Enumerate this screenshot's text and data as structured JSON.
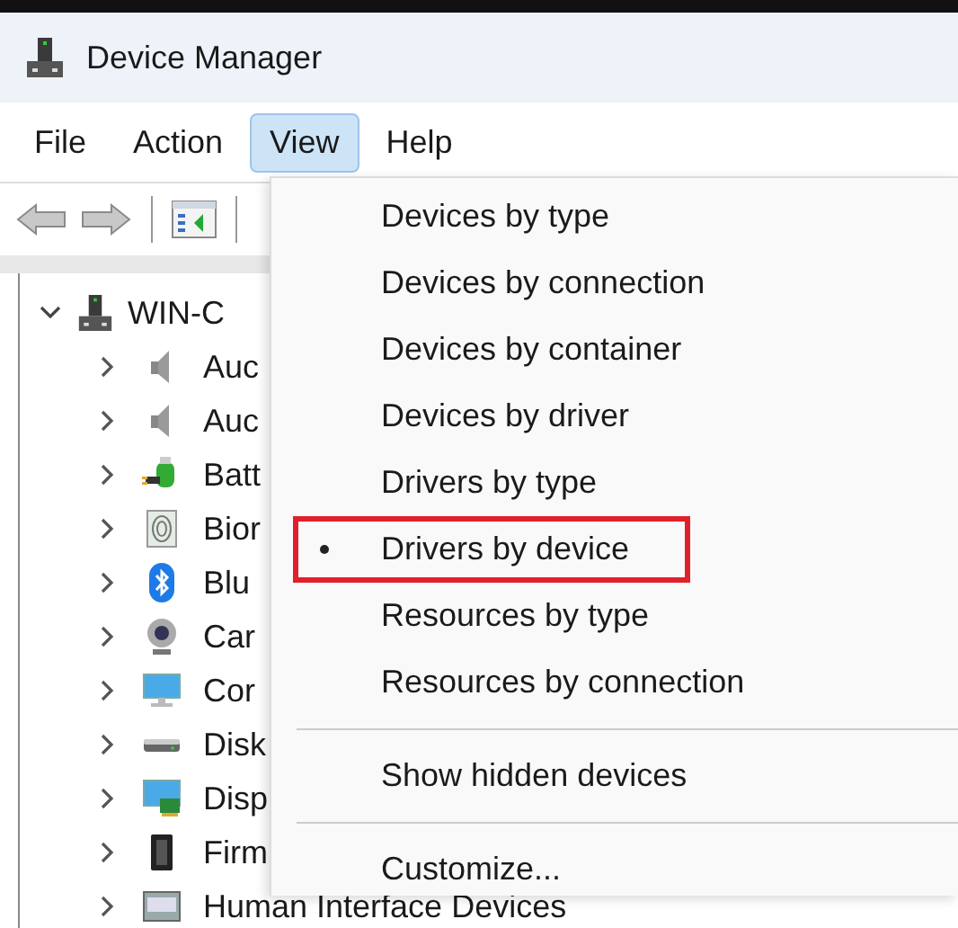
{
  "window": {
    "title": "Device Manager"
  },
  "menu_bar": [
    {
      "label": "File",
      "selected": false
    },
    {
      "label": "Action",
      "selected": false
    },
    {
      "label": "View",
      "selected": true
    },
    {
      "label": "Help",
      "selected": false
    }
  ],
  "toolbar": [
    {
      "kind": "back",
      "disabled": true
    },
    {
      "kind": "forward",
      "disabled": true
    },
    {
      "kind": "separator"
    },
    {
      "kind": "properties"
    },
    {
      "kind": "separator"
    }
  ],
  "tree": {
    "label": "WIN-C",
    "expanded": true,
    "children": [
      {
        "label": "Auc",
        "expanded": false
      },
      {
        "label": "Auc",
        "expanded": false
      },
      {
        "label": "Batt",
        "expanded": false
      },
      {
        "label": "Bior",
        "expanded": false
      },
      {
        "label": "Blu",
        "expanded": false
      },
      {
        "label": "Car",
        "expanded": false
      },
      {
        "label": "Cor",
        "expanded": false
      },
      {
        "label": "Disk",
        "expanded": false
      },
      {
        "label": "Disp",
        "expanded": false
      },
      {
        "label": "Firm",
        "expanded": false
      },
      {
        "label": "Human Interface Devices",
        "expanded": false
      }
    ]
  },
  "view_menu": {
    "groups": [
      [
        {
          "label": "Devices by type",
          "selected": false,
          "highlighted": false
        },
        {
          "label": "Devices by connection",
          "selected": false,
          "highlighted": false
        },
        {
          "label": "Devices by container",
          "selected": false,
          "highlighted": false
        },
        {
          "label": "Devices by driver",
          "selected": false,
          "highlighted": false
        },
        {
          "label": "Drivers by type",
          "selected": false,
          "highlighted": false
        },
        {
          "label": "Drivers by device",
          "selected": true,
          "highlighted": true
        },
        {
          "label": "Resources by type",
          "selected": false,
          "highlighted": false
        },
        {
          "label": "Resources by connection",
          "selected": false,
          "highlighted": false
        }
      ],
      [
        {
          "label": "Show hidden devices",
          "selected": false,
          "highlighted": false
        }
      ],
      [
        {
          "label": "Customize...",
          "selected": false,
          "highlighted": false
        }
      ]
    ]
  }
}
